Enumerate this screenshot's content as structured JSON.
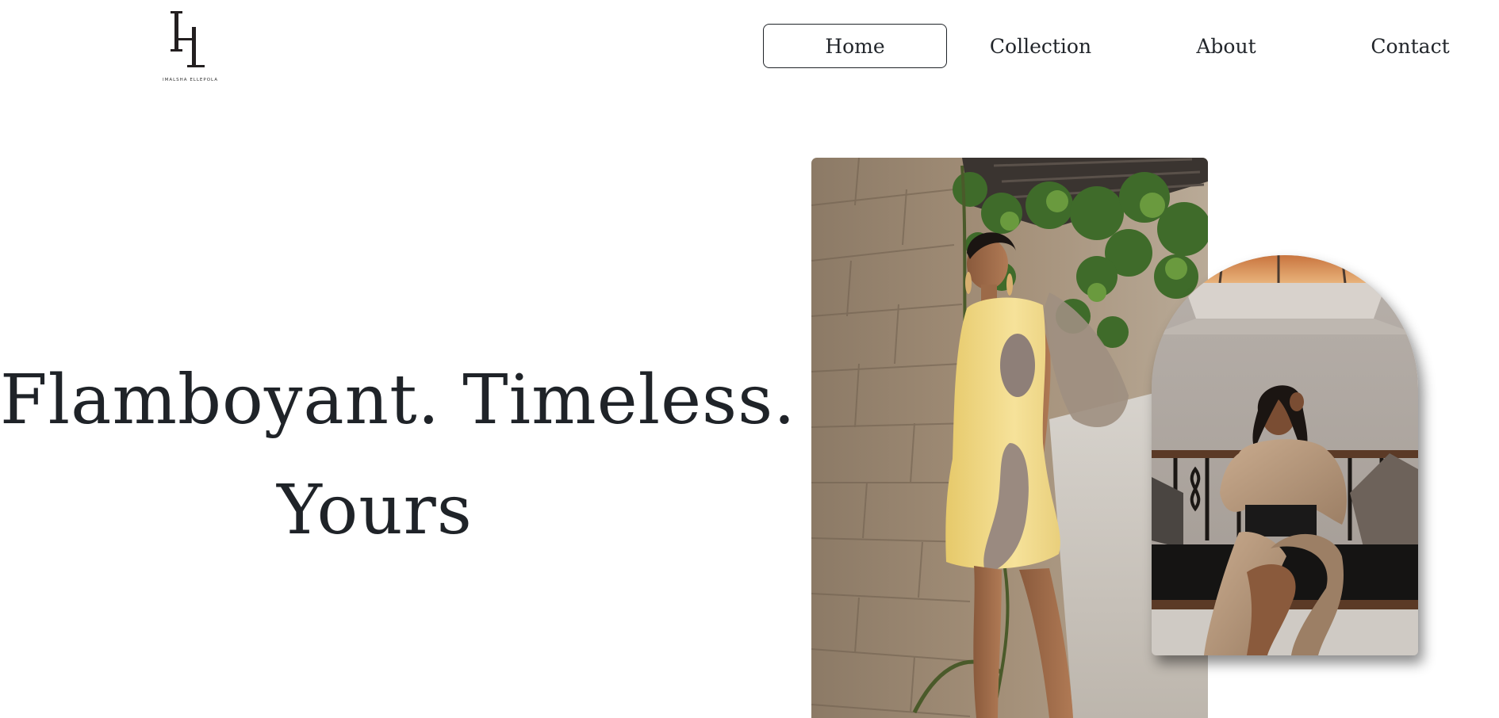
{
  "logo": {
    "monogram": "IE",
    "name": "IMALSHA ELLEPOLA"
  },
  "nav": {
    "items": [
      {
        "label": "Home",
        "active": true
      },
      {
        "label": "Collection",
        "active": false
      },
      {
        "label": "About",
        "active": false
      },
      {
        "label": "Contact",
        "active": false
      }
    ]
  },
  "hero": {
    "line1": "Flamboyant. Timeless.",
    "line2": "Yours"
  },
  "images": {
    "main": {
      "icon": "fashion-photo-yellow-dress"
    },
    "secondary": {
      "icon": "fashion-photo-arch"
    }
  },
  "colors": {
    "text": "#1f2328",
    "background": "#ffffff",
    "accent_yellow": "#f3dd8a"
  }
}
